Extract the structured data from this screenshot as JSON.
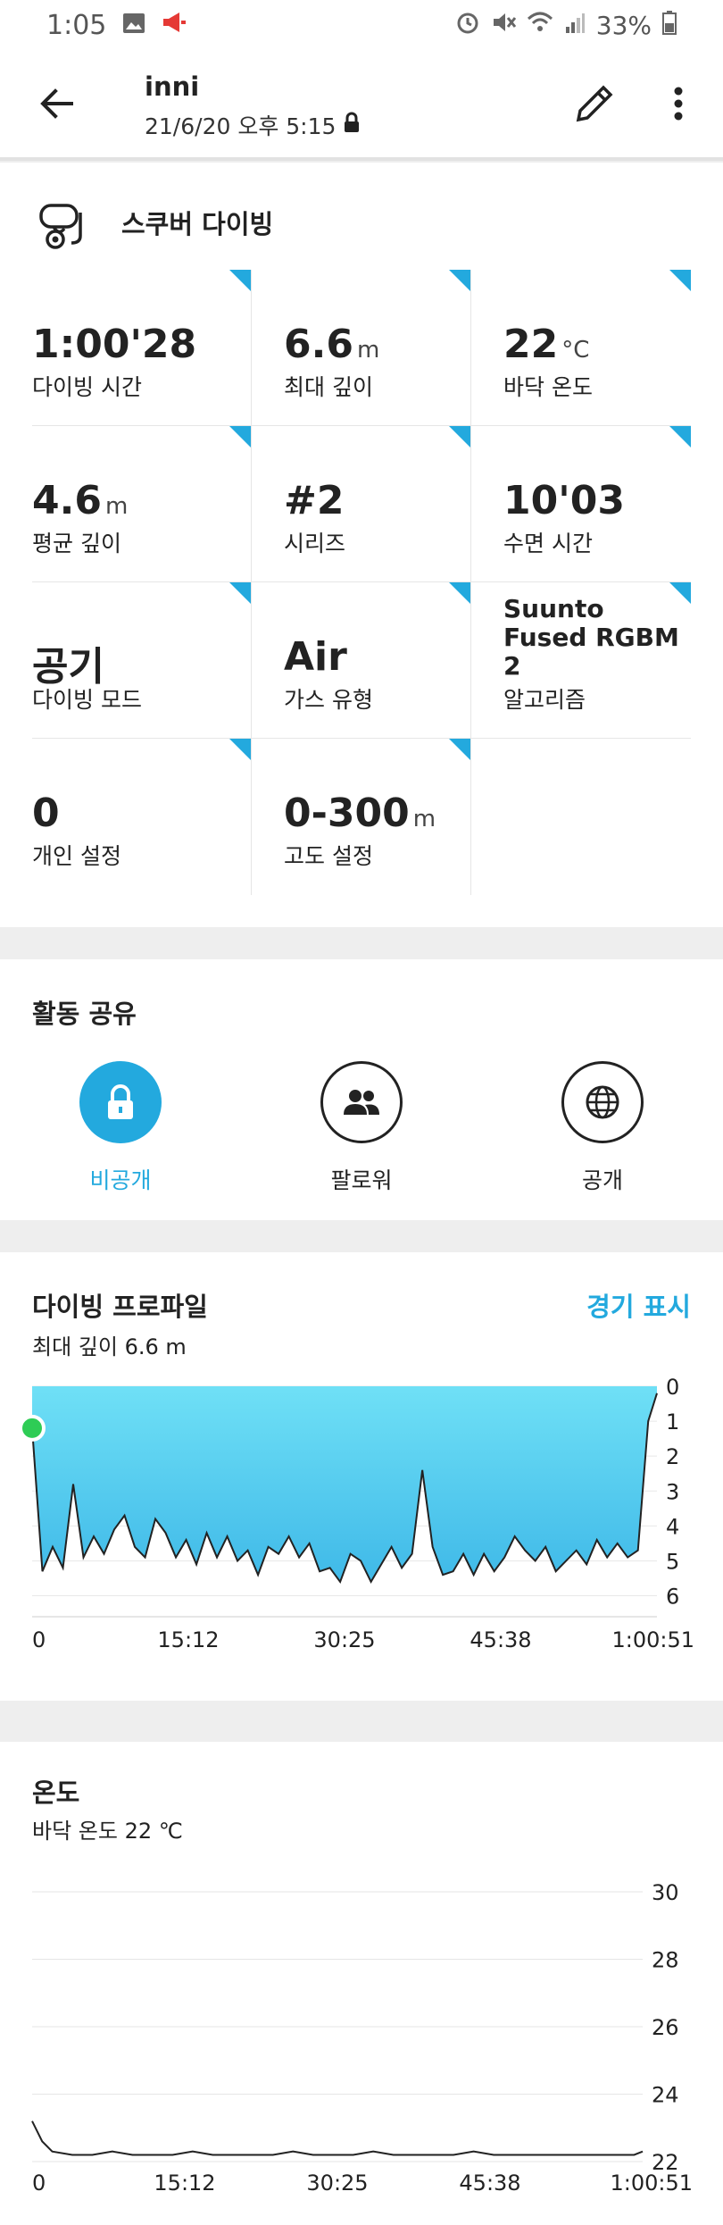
{
  "status_bar": {
    "time": "1:05",
    "battery": "33%",
    "icons": [
      "image-icon",
      "megaphone-icon",
      "alarm-icon",
      "mute-icon",
      "wifi-icon",
      "signal-icon",
      "battery-icon"
    ]
  },
  "header": {
    "title": "inni",
    "subtitle": "21/6/20 오후 5:15",
    "icons": [
      "back-arrow-icon",
      "lock-icon",
      "pencil-icon",
      "more-vert-icon"
    ]
  },
  "summary": {
    "sport": "스쿠버 다이빙",
    "sport_icon": "scuba-mask-icon",
    "stats": [
      {
        "value": "1:00'28",
        "unit": "",
        "label": "다이빙 시간"
      },
      {
        "value": "6.6",
        "unit": "m",
        "label": "최대 깊이"
      },
      {
        "value": "22",
        "unit": "°C",
        "label": "바닥 온도"
      },
      {
        "value": "4.6",
        "unit": "m",
        "label": "평균 깊이"
      },
      {
        "value": "#2",
        "unit": "",
        "label": "시리즈"
      },
      {
        "value": "10'03",
        "unit": "",
        "label": "수면 시간"
      },
      {
        "value": "공기",
        "unit": "",
        "label": "다이빙 모드"
      },
      {
        "value": "Air",
        "unit": "",
        "label": "가스 유형"
      },
      {
        "value": "Suunto Fused RGBM 2",
        "unit": "",
        "label": "알고리즘"
      },
      {
        "value": "0",
        "unit": "",
        "label": "개인 설정"
      },
      {
        "value": "0-300",
        "unit": "m",
        "label": "고도 설정"
      }
    ]
  },
  "share": {
    "title": "활동 공유",
    "options": [
      {
        "label": "비공개",
        "icon": "lock-icon",
        "selected": true
      },
      {
        "label": "팔로워",
        "icon": "people-icon",
        "selected": false
      },
      {
        "label": "공개",
        "icon": "globe-icon",
        "selected": false
      }
    ],
    "accent": "#23a9de"
  },
  "dive_profile": {
    "title": "다이빙 프로파일",
    "action": "경기 표시",
    "subtitle": "최대 깊이 6.6 m"
  },
  "temperature": {
    "title": "온도",
    "subtitle": "바닥 온도 22 ℃"
  },
  "chart_data": [
    {
      "type": "area",
      "x_ticks": [
        "0",
        "15:12",
        "30:25",
        "45:38",
        "1:00:51"
      ],
      "y_ticks": [
        "0",
        "1",
        "2",
        "3",
        "4",
        "5",
        "6"
      ],
      "ylim": [
        0,
        6.6
      ],
      "y_inverted": true,
      "x_range_min": [
        0,
        60.85
      ],
      "fill_color": "#5fd3f0",
      "series": [
        {
          "x": [
            0,
            1,
            2,
            3,
            4,
            5,
            6,
            7,
            8,
            9,
            10,
            11,
            12,
            13,
            14,
            15,
            16,
            17,
            18,
            19,
            20,
            21,
            22,
            23,
            24,
            25,
            26,
            27,
            28,
            29,
            30,
            31,
            32,
            33,
            34,
            35,
            36,
            37,
            38,
            39,
            40,
            41,
            42,
            43,
            44,
            45,
            46,
            47,
            48,
            49,
            50,
            51,
            52,
            53,
            54,
            55,
            56,
            57,
            58,
            59,
            60,
            60.85
          ],
          "values": [
            1.2,
            5.3,
            4.6,
            5.2,
            2.8,
            4.9,
            4.3,
            4.8,
            4.1,
            3.7,
            4.6,
            4.9,
            3.8,
            4.2,
            4.9,
            4.4,
            5.1,
            4.2,
            4.9,
            4.3,
            5.0,
            4.7,
            5.4,
            4.6,
            4.8,
            4.3,
            4.9,
            4.5,
            5.3,
            5.2,
            5.6,
            4.8,
            5.0,
            5.6,
            5.1,
            4.6,
            5.2,
            4.8,
            2.4,
            4.6,
            5.4,
            5.3,
            4.8,
            5.4,
            4.8,
            5.3,
            4.9,
            4.3,
            4.7,
            5.0,
            4.6,
            5.3,
            5.0,
            4.7,
            5.1,
            4.4,
            4.9,
            4.5,
            4.9,
            4.7,
            1.0,
            0.2
          ]
        }
      ]
    },
    {
      "type": "line",
      "x_ticks": [
        "0",
        "15:12",
        "30:25",
        "45:38",
        "1:00:51"
      ],
      "y_ticks": [
        "30",
        "28",
        "26",
        "24",
        "22"
      ],
      "ylim": [
        22,
        30
      ],
      "x_range_min": [
        0,
        60.85
      ],
      "series": [
        {
          "x": [
            0,
            1,
            2,
            4,
            6,
            8,
            10,
            12,
            14,
            16,
            18,
            20,
            22,
            24,
            26,
            28,
            30,
            32,
            34,
            36,
            38,
            40,
            42,
            44,
            46,
            48,
            50,
            52,
            54,
            56,
            58,
            60,
            60.85
          ],
          "values": [
            23.2,
            22.6,
            22.3,
            22.2,
            22.2,
            22.3,
            22.2,
            22.2,
            22.2,
            22.3,
            22.2,
            22.2,
            22.2,
            22.2,
            22.3,
            22.2,
            22.2,
            22.2,
            22.3,
            22.2,
            22.2,
            22.2,
            22.2,
            22.3,
            22.2,
            22.2,
            22.2,
            22.2,
            22.2,
            22.2,
            22.2,
            22.2,
            22.3
          ]
        }
      ]
    }
  ]
}
